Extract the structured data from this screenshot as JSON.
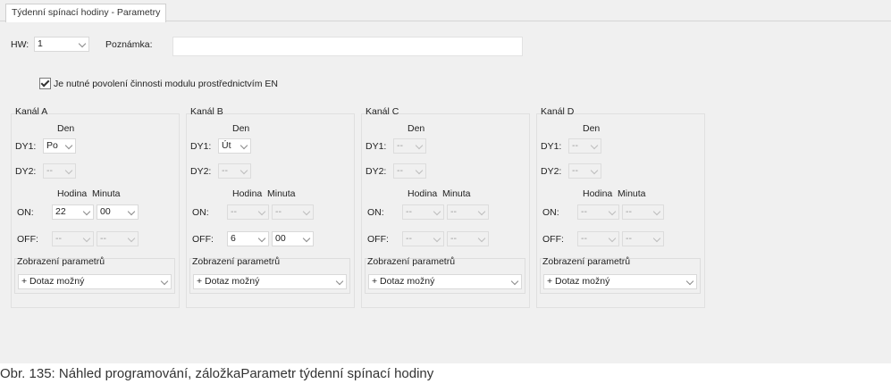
{
  "tab": {
    "label": "Týdenní spínací hodiny - Parametry"
  },
  "hw": {
    "label": "HW:",
    "value": "1"
  },
  "note": {
    "label": "Poznámka:",
    "value": ""
  },
  "enable": {
    "label": "Je nutné povolení činnosti modulu prostřednictvím EN",
    "checked": true
  },
  "labels": {
    "den": "Den",
    "dy1": "DY1:",
    "dy2": "DY2:",
    "hodina": "Hodina",
    "minuta": "Minuta",
    "on": "ON:",
    "off": "OFF:",
    "display_group": "Zobrazení parametrů"
  },
  "channels": [
    {
      "title": "Kanál A",
      "dy1": "Po",
      "dy2": "--",
      "on_hour": "22",
      "on_min": "00",
      "off_hour": "--",
      "off_min": "--",
      "display": "+ Dotaz možný"
    },
    {
      "title": "Kanál B",
      "dy1": "Út",
      "dy2": "--",
      "on_hour": "--",
      "on_min": "--",
      "off_hour": "6",
      "off_min": "00",
      "display": "+ Dotaz možný"
    },
    {
      "title": "Kanál C",
      "dy1": "--",
      "dy2": "--",
      "on_hour": "--",
      "on_min": "--",
      "off_hour": "--",
      "off_min": "--",
      "display": "+ Dotaz možný"
    },
    {
      "title": "Kanál D",
      "dy1": "--",
      "dy2": "--",
      "on_hour": "--",
      "on_min": "--",
      "off_hour": "--",
      "off_min": "--",
      "display": "+ Dotaz možný"
    }
  ],
  "caption": "Obr. 135: Náhled programování, záložkaParametr týdenní spínací hodiny"
}
